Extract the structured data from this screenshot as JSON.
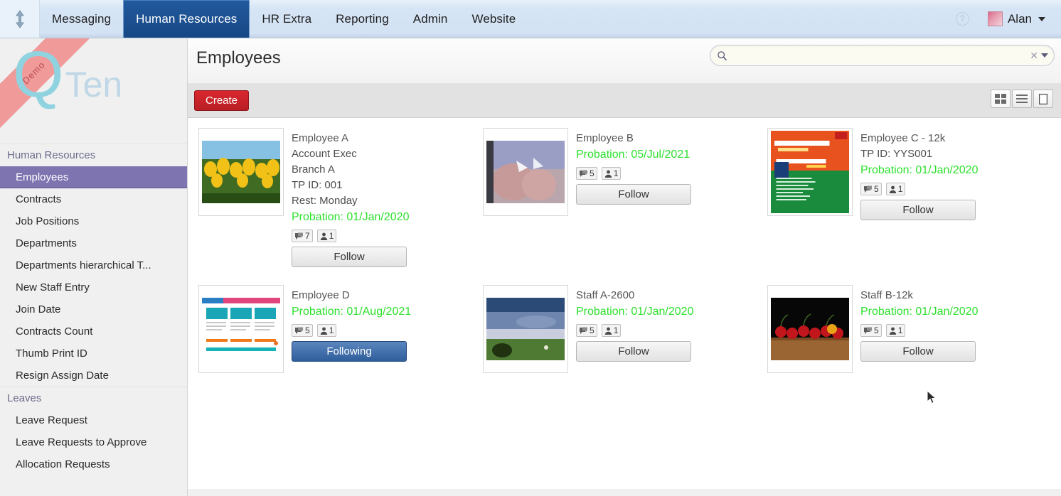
{
  "navbar": {
    "home_icon": "up-down-arrow-icon",
    "tabs": [
      {
        "label": "Messaging",
        "active": false
      },
      {
        "label": "Human Resources",
        "active": true
      },
      {
        "label": "HR Extra",
        "active": false
      },
      {
        "label": "Reporting",
        "active": false
      },
      {
        "label": "Admin",
        "active": false
      },
      {
        "label": "Website",
        "active": false
      }
    ],
    "help_icon": "question-mark-icon",
    "user_name": "Alan",
    "avatar_icon": "user-avatar"
  },
  "sidebar": {
    "ribbon_label": "Demo",
    "logo_q": "Q",
    "logo_ten": "Ten",
    "sections": [
      {
        "group": "Human Resources",
        "items": [
          {
            "label": "Employees",
            "selected": true
          },
          {
            "label": "Contracts",
            "selected": false
          },
          {
            "label": "Job Positions",
            "selected": false
          },
          {
            "label": "Departments",
            "selected": false
          },
          {
            "label": "Departments hierarchical T...",
            "selected": false
          },
          {
            "label": "New Staff Entry",
            "selected": false
          },
          {
            "label": "Join Date",
            "selected": false
          },
          {
            "label": "Contracts Count",
            "selected": false
          },
          {
            "label": "Thumb Print ID",
            "selected": false
          },
          {
            "label": "Resign Assign Date",
            "selected": false
          }
        ]
      },
      {
        "group": "Leaves",
        "items": [
          {
            "label": "Leave Request",
            "selected": false
          },
          {
            "label": "Leave Requests to Approve",
            "selected": false
          },
          {
            "label": "Allocation Requests",
            "selected": false
          }
        ]
      }
    ]
  },
  "main": {
    "page_title": "Employees",
    "search": {
      "icon": "search-icon",
      "value": "",
      "placeholder": "",
      "clear_icon": "clear-x-icon",
      "caret_icon": "chevron-down-icon"
    },
    "toolbar": {
      "create_label": "Create",
      "views": [
        {
          "name": "kanban-view",
          "icon": "grid-icon",
          "active": true
        },
        {
          "name": "list-view",
          "icon": "list-icon",
          "active": false
        },
        {
          "name": "form-view",
          "icon": "form-icon",
          "active": false
        }
      ]
    },
    "cards": [
      {
        "title": "Employee A",
        "lines": [
          "Account Exec",
          "Branch A",
          "TP ID: 001",
          "Rest: Monday"
        ],
        "probation": "Probation: 01/Jan/2020",
        "messages": "7",
        "followers": "1",
        "follow_label": "Follow",
        "following": false,
        "image": "yellow-tulips-photo"
      },
      {
        "title": "Employee B",
        "lines": [],
        "probation": "Probation: 05/Jul/2021",
        "messages": "5",
        "followers": "1",
        "follow_label": "Follow",
        "following": false,
        "image": "hands-photo"
      },
      {
        "title": "Employee C - 12k",
        "lines": [
          "TP ID: YYS001"
        ],
        "probation": "Probation: 01/Jan/2020",
        "messages": "5",
        "followers": "1",
        "follow_label": "Follow",
        "following": false,
        "image": "book-cover-modul-efektif"
      },
      {
        "title": "Employee D",
        "lines": [],
        "probation": "Probation: 01/Aug/2021",
        "messages": "5",
        "followers": "1",
        "follow_label": "Following",
        "following": true,
        "image": "webpage-screenshot"
      },
      {
        "title": "Staff A-2600",
        "lines": [],
        "probation": "Probation: 01/Jan/2020",
        "messages": "5",
        "followers": "1",
        "follow_label": "Follow",
        "following": false,
        "image": "landscape-sky-photo"
      },
      {
        "title": "Staff B-12k",
        "lines": [],
        "probation": "Probation: 01/Jan/2020",
        "messages": "5",
        "followers": "1",
        "follow_label": "Follow",
        "following": false,
        "image": "cherries-photo"
      }
    ]
  },
  "colors": {
    "accent_blue": "#1a4e93",
    "navbar_bg": "#d3e2f4",
    "sidebar_selected": "#7d74b0",
    "probation_green": "#2ee02e",
    "create_red": "#c52229",
    "following_blue": "#2f5e9c"
  }
}
